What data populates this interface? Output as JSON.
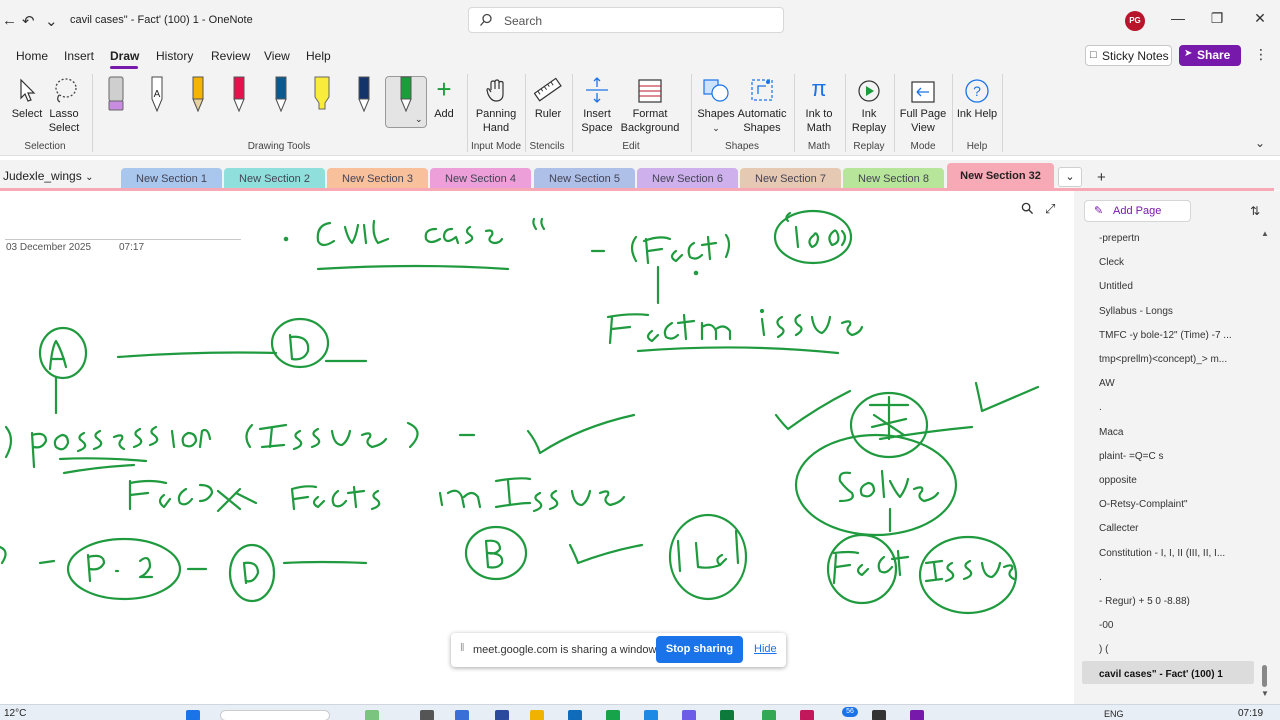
{
  "titlebar": {
    "title": "cavil cases\" - Fact' (100) 1  -  OneNote",
    "search_placeholder": "Search",
    "avatar_initials": "PG"
  },
  "menu": {
    "items": [
      "Home",
      "Insert",
      "Draw",
      "History",
      "Review",
      "View",
      "Help"
    ],
    "active": "Draw",
    "sticky_notes": "Sticky Notes",
    "share": "Share"
  },
  "ribbon": {
    "select": "Select",
    "lasso": "Lasso Select",
    "add": "Add",
    "panning": "Panning Hand",
    "ruler": "Ruler",
    "insert_space": "Insert Space",
    "format_bg": "Format Background",
    "shapes": "Shapes",
    "auto_shapes": "Automatic Shapes",
    "ink_to_math": "Ink to Math",
    "ink_replay": "Ink Replay",
    "full_page": "Full Page View",
    "ink_help": "Ink Help",
    "groups": {
      "selection": "Selection",
      "drawing_tools": "Drawing Tools",
      "input_mode": "Input Mode",
      "stencils": "Stencils",
      "edit": "Edit",
      "shapes": "Shapes",
      "math": "Math",
      "replay": "Replay",
      "mode": "Mode",
      "help": "Help"
    },
    "pen_colors": [
      "#cfcfcf",
      "#ffffff",
      "#f5b400",
      "#e3124d",
      "#0a5a8f",
      "#f9ec3a",
      "#12346b",
      "#1a9e3a"
    ]
  },
  "sections": {
    "notebook": "Judexle_wings",
    "tabs": [
      {
        "label": "New Section 1",
        "color": "#a9c6ec"
      },
      {
        "label": "New Section 2",
        "color": "#8fe0dc"
      },
      {
        "label": "New Section 3",
        "color": "#f8c19b"
      },
      {
        "label": "New Section 4",
        "color": "#ec9fd8"
      },
      {
        "label": "New Section 5",
        "color": "#aebfe8"
      },
      {
        "label": "New Section 6",
        "color": "#cdb0ec"
      },
      {
        "label": "New Section 7",
        "color": "#e6c9b3"
      },
      {
        "label": "New Section 8",
        "color": "#b7e69a"
      }
    ],
    "active_tab": {
      "label": "New Section 32",
      "color": "#f7a9b5"
    }
  },
  "page": {
    "date": "03 December 2025",
    "time": "07:17",
    "ink_color": "#1f9a3e"
  },
  "share_notice": {
    "text": "meet.google.com is sharing a window.",
    "stop": "Stop sharing",
    "hide": "Hide"
  },
  "pagelist": {
    "add_page": "Add Page",
    "items": [
      "-prepertn",
      "Cleck",
      "Untitled",
      "Syllabus - Longs",
      "TMFC -y bole-12\" (Time) -7 ...",
      "tmp<prellm)<concept)_> m...",
      "AW",
      ".",
      "Maca",
      "plaint- =Q=C s",
      "opposite",
      "O-Retsy-Complaint\"",
      "Callecter",
      "Constitution - I, I, II (III, II, I...",
      ".",
      "- Regur) + 5 0 -8.88)",
      "-00",
      ") (",
      "cavil cases\" - Fact' (100) 1"
    ]
  },
  "taskbar": {
    "weather": "12°C",
    "lang": "ENG",
    "time": "07:19",
    "badge": "56"
  }
}
